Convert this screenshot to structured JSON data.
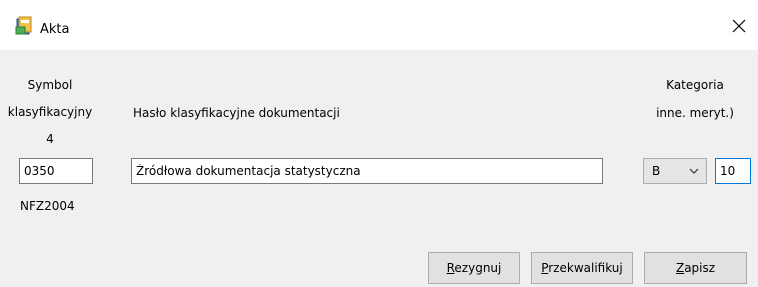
{
  "window": {
    "title": "Akta",
    "icon": "binder-icon",
    "close_glyph": "✕"
  },
  "form": {
    "symbol_label_line1": "Symbol",
    "symbol_label_line2": "klasyfikacyjny",
    "symbol_label_line3": "4",
    "symbol_value": "0350",
    "symbol_source": "NFZ2004",
    "haslo_label": "Hasło klasyfikacyjne dokumentacji",
    "haslo_value": "Źródłowa dokumentacja statystyczna",
    "kategoria_label_line1": "Kategoria",
    "kategoria_label_line2": "inne. meryt.)",
    "kategoria_selected": "B",
    "kategoria_years_value": "10"
  },
  "buttons": {
    "rezygnuj": {
      "accel": "R",
      "rest": "ezygnuj"
    },
    "przekwalifikuj": {
      "accel": "P",
      "rest": "rzekwalifikuj"
    },
    "zapisz": {
      "accel": "Z",
      "rest": "apisz"
    }
  }
}
